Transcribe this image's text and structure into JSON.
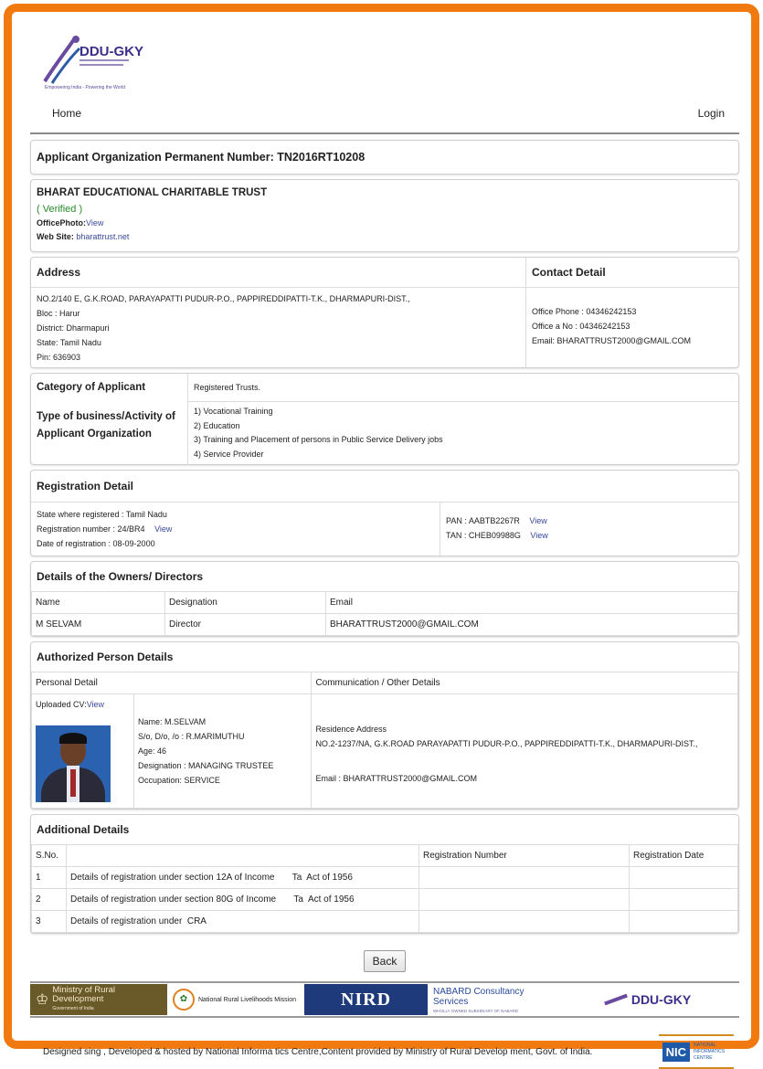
{
  "header": {
    "brand": "DDU-GKY",
    "tagline": "Empowering India - Powering the World"
  },
  "nav": {
    "home": "Home",
    "login": "Login"
  },
  "org": {
    "perm_label": "Applicant Organization Permanent Number:",
    "perm_number": "TN2016RT10208",
    "name": "BHARAT EDUCATIONAL CHARITABLE TRUST",
    "status": "( Verified )",
    "office_photo_label": "OfficePhoto:",
    "office_photo_link": "View",
    "website_label": "Web Site:",
    "website": "bharattrust.net"
  },
  "address": {
    "title": "Address",
    "line1": "NO.2/140 E, G.K.ROAD, PARAYAPATTI PUDUR-P.O., PAPPIREDDIPATTI-T.K., DHARMAPURI-DIST.,",
    "bloc": "Bloc : Harur",
    "district": "District: Dharmapuri",
    "state": "State: Tamil Nadu",
    "pin": "Pin: 636903"
  },
  "contact": {
    "title": "Contact Detail",
    "phone": "Office Phone : 04346242153",
    "fax": "Office a No : 04346242153",
    "email": "Email: BHARATTRUST2000@GMAIL.COM"
  },
  "category": {
    "label": "Category of Applicant",
    "value": "Registered Trusts.",
    "business_label": "Type of business/Activity of Applicant Organization",
    "activities": [
      "1)   Vocational Training",
      "2)   Education",
      "3)   Training and Placement of persons in Public Service Delivery jobs",
      "4)   Service Provider"
    ]
  },
  "registration": {
    "title": "Registration Detail",
    "state": "State where registered : Tamil Nadu",
    "number": "Registration number : 24/BR4",
    "number_link": "View",
    "date": "Date of registration : 08-09-2000",
    "pan": "PAN : AABTB2267R",
    "pan_link": "View",
    "tan": "TAN : CHEB09988G",
    "tan_link": "View"
  },
  "owners": {
    "title": "Details of the Owners/ Directors",
    "headers": [
      "Name",
      "Designation",
      "Email"
    ],
    "rows": [
      [
        "M SELVAM",
        "Director",
        "BHARATTRUST2000@GMAIL.COM"
      ]
    ]
  },
  "authorized": {
    "title": "Authorized Person Details",
    "personal_header": "Personal Detail",
    "comm_header": "Communication / Other Details",
    "cv_label": "Uploaded CV:",
    "cv_link": "View",
    "name": "Name: M.SELVAM",
    "relation": "S/o, D/o, /o : R.MARIMUTHU",
    "age": "Age: 46",
    "designation": "Designation : MANAGING TRUSTEE",
    "occupation": "Occupation: SERVICE",
    "residence_label": "Residence Address",
    "residence": "NO.2-1237/NA, G.K.ROAD PARAYAPATTI PUDUR-P.O., PAPPIREDDIPATTI-T.K., DHARMAPURI-DIST.,",
    "email": "Email : BHARATTRUST2000@GMAIL.COM"
  },
  "additional": {
    "title": "Additional Details",
    "headers": [
      "S.No.",
      "",
      "Registration Number",
      "Registration Date"
    ],
    "rows": [
      [
        "1",
        "Details of registration under section 12A of Income       Ta  Act of 1956",
        "",
        ""
      ],
      [
        "2",
        "Details of registration under section 80G of Income       Ta  Act of 1956",
        "",
        ""
      ],
      [
        "3",
        "Details of registration under  CRA",
        "",
        ""
      ]
    ]
  },
  "back_button": "Back",
  "footer": {
    "ministry": "Ministry of Rural Development",
    "ministry_sub": "Government of India",
    "nrlm": "National Rural Livelihoods Mission",
    "nird": "NIRD",
    "nabard": "NABARD Consultancy Services",
    "nabard_sub": "WHOLLY OWNED SUBSIDIARY OF NABARD",
    "ddugky": "DDU-GKY",
    "credit": "Designed sing , Developed & hosted by National Informa tics Centre,Content provided by Ministry of Rural Develop ment, Govt. of India.",
    "nic": "NIC",
    "nic_sub": "NATIONAL INFORMATICS CENTRE"
  }
}
